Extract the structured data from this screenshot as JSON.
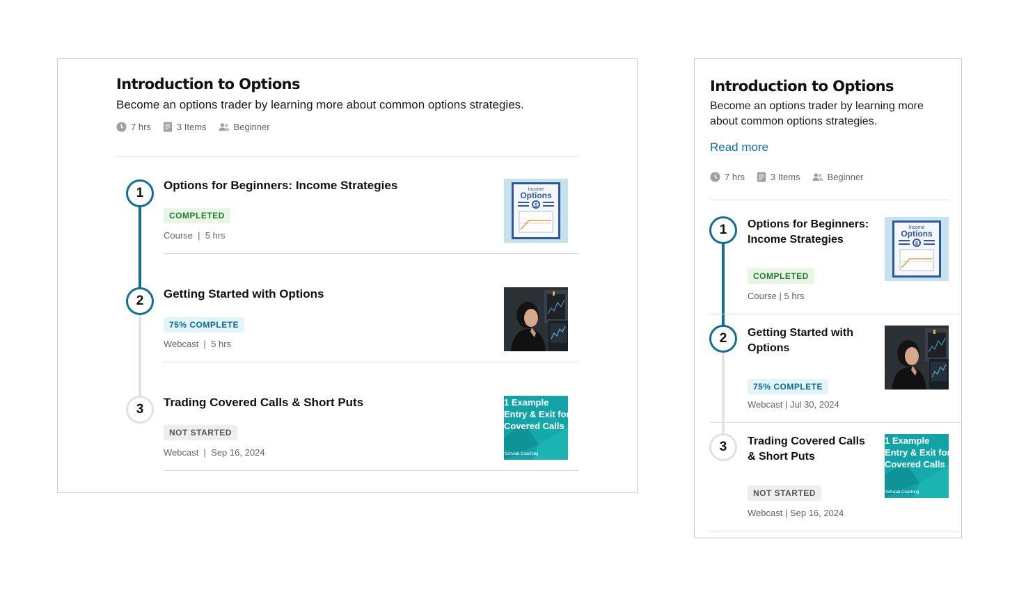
{
  "course": {
    "title": "Introduction to Options",
    "description": "Become an options trader by learning more about common options strategies.",
    "description_line1": "Become an options trader by learning more",
    "description_line2": "about common options strategies.",
    "read_more": "Read more",
    "meta": {
      "duration": "7 hrs",
      "items": "3 Items",
      "level": "Beginner"
    }
  },
  "items": [
    {
      "number": "1",
      "title": "Options for Beginners: Income Strategies",
      "title_line1": "Options for Beginners:",
      "title_line2": "Income Strategies",
      "status": "COMPLETED",
      "meta_desktop": "Course  |  5 hrs",
      "meta_mobile": "Course | 5 hrs",
      "thumb": {
        "label_small": "Income",
        "label_big": "Options",
        "symbol": "$"
      }
    },
    {
      "number": "2",
      "title": "Getting Started with Options",
      "title_line1": "Getting Started with",
      "title_line2": "Options",
      "status": "75% COMPLETE",
      "progress": 0.75,
      "meta_desktop": "Webcast  |  5 hrs",
      "meta_mobile": "Webcast | Jul 30, 2024"
    },
    {
      "number": "3",
      "title": "Trading Covered Calls & Short Puts",
      "title_line1": "Trading Covered Calls",
      "title_line2": "& Short Puts",
      "status": "NOT STARTED",
      "meta_desktop": "Webcast  |  Sep 16, 2024",
      "meta_mobile": "Webcast | Sep 16, 2024",
      "thumb": {
        "line1": "1 Example",
        "line2": "Entry & Exit for",
        "line3": "Covered Calls",
        "brand": "Schwab Coaching"
      }
    }
  ],
  "colors": {
    "accent": "#0f6e93",
    "link": "#0b6fa4",
    "completed_bg": "#e8f5e4",
    "completed_text": "#237a2b",
    "progress_bg": "#e4f4fb",
    "progress_text": "#0b6b94",
    "notstarted_bg": "#eeeeee",
    "teal_thumb": "#13a3a6"
  },
  "icons": {
    "duration": "clock-icon",
    "items": "document-icon",
    "level": "people-icon"
  }
}
